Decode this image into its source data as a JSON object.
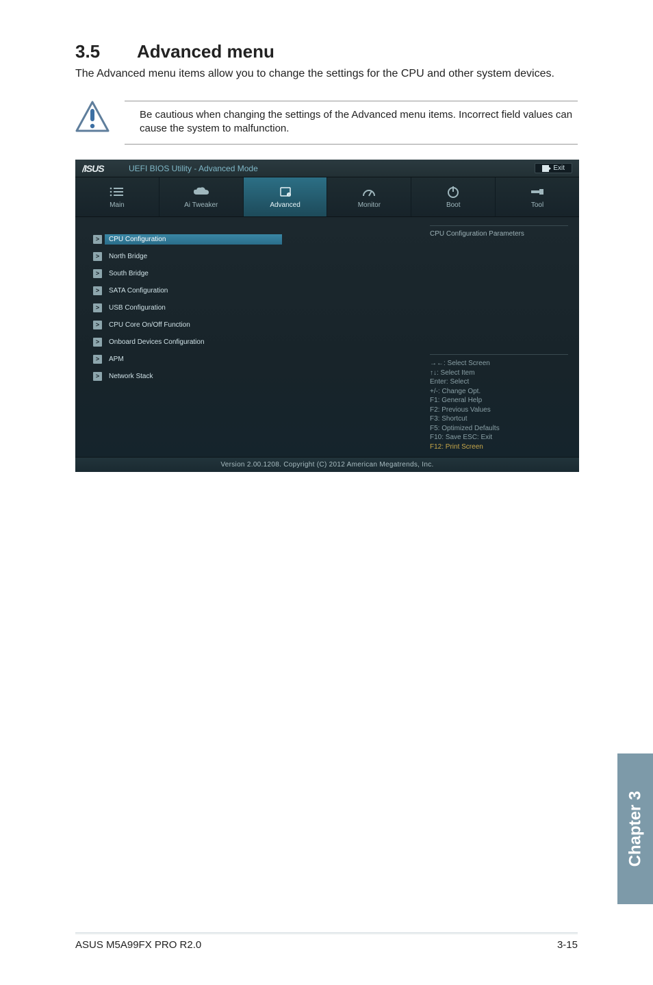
{
  "section": {
    "number": "3.5",
    "title": "Advanced menu"
  },
  "intro": "The Advanced menu items allow you to change the settings for the CPU and other system devices.",
  "caution": "Be cautious when changing the settings of the Advanced menu items. Incorrect field values can cause the system to malfunction.",
  "bios": {
    "title": "UEFI BIOS Utility - Advanced Mode",
    "exit_label": "Exit",
    "tabs": [
      "Main",
      "Ai  Tweaker",
      "Advanced",
      "Monitor",
      "Boot",
      "Tool"
    ],
    "active_tab": "Advanced",
    "menu": [
      "CPU Configuration",
      "North Bridge",
      "South Bridge",
      "SATA Configuration",
      "USB Configuration",
      "CPU Core On/Off Function",
      "Onboard Devices Configuration",
      "APM",
      "Network Stack"
    ],
    "selected_menu": "CPU Configuration",
    "help_title": "CPU Configuration Parameters",
    "help_keys": [
      "→←:  Select Screen",
      "↑↓:  Select Item",
      "Enter:  Select",
      "+/-:  Change Opt.",
      "F1:  General Help",
      "F2:  Previous Values",
      "F3:  Shortcut",
      "F5:  Optimized Defaults",
      "F10:  Save    ESC:  Exit",
      "F12: Print Screen"
    ],
    "footer": "Version  2.00.1208.   Copyright  (C)  2012 American  Megatrends,  Inc."
  },
  "chapter_tab": "Chapter 3",
  "footer_left": "ASUS M5A99FX PRO R2.0",
  "footer_right": "3-15"
}
